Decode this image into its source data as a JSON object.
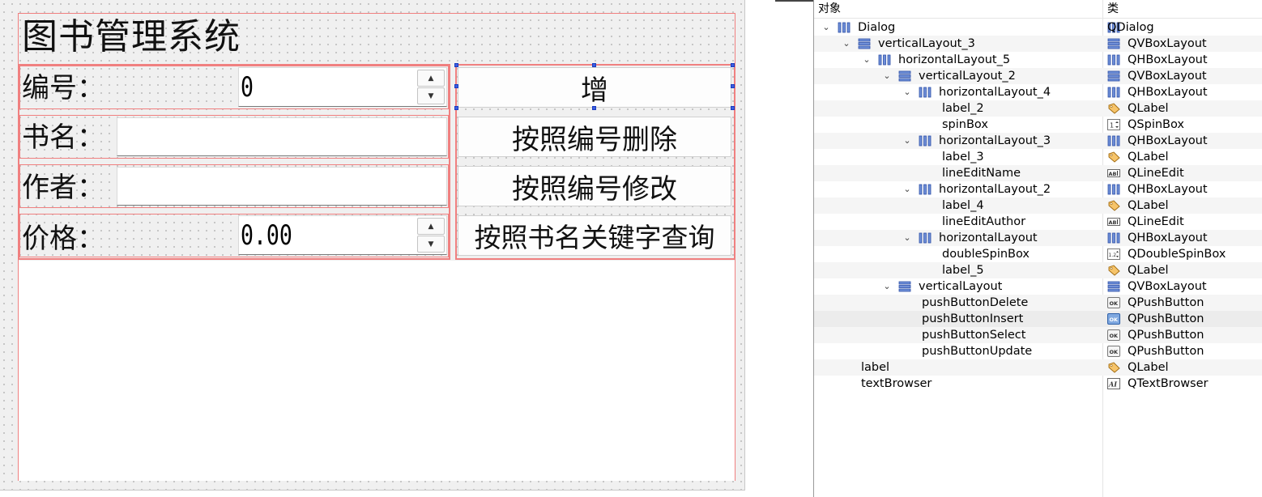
{
  "dialog": {
    "title": "图书管理系统",
    "fields": {
      "id_label": "编号：",
      "id_value": "0",
      "name_label": "书名：",
      "author_label": "作者：",
      "price_label": "价格：",
      "price_value": "0.00"
    },
    "buttons": {
      "insert": "增",
      "delete_by_id": "按照编号删除",
      "update_by_id": "按照编号修改",
      "search_by_keyword": "按照书名关键字查询"
    }
  },
  "inspector": {
    "header": {
      "object": "对象",
      "class": "类"
    },
    "rows": [
      {
        "name": "Dialog",
        "class": "QDialog",
        "icon": "hbox-icon",
        "cicon": "",
        "expand": true
      },
      {
        "name": "verticalLayout_3",
        "class": "QVBoxLayout",
        "icon": "vbox-icon",
        "cicon": "vbox-icon",
        "expand": true
      },
      {
        "name": "horizontalLayout_5",
        "class": "QHBoxLayout",
        "icon": "hbox-icon",
        "cicon": "hbox-icon",
        "expand": true
      },
      {
        "name": "verticalLayout_2",
        "class": "QVBoxLayout",
        "icon": "vbox-icon",
        "cicon": "vbox-icon",
        "expand": true
      },
      {
        "name": "horizontalLayout_4",
        "class": "QHBoxLayout",
        "icon": "hbox-icon",
        "cicon": "hbox-icon",
        "expand": true
      },
      {
        "name": "label_2",
        "class": "QLabel",
        "icon": "",
        "cicon": "label-icon",
        "expand": false
      },
      {
        "name": "spinBox",
        "class": "QSpinBox",
        "icon": "",
        "cicon": "spinbox-icon",
        "expand": false
      },
      {
        "name": "horizontalLayout_3",
        "class": "QHBoxLayout",
        "icon": "hbox-icon",
        "cicon": "hbox-icon",
        "expand": true
      },
      {
        "name": "label_3",
        "class": "QLabel",
        "icon": "",
        "cicon": "label-icon",
        "expand": false
      },
      {
        "name": "lineEditName",
        "class": "QLineEdit",
        "icon": "",
        "cicon": "lineedit-icon",
        "expand": false
      },
      {
        "name": "horizontalLayout_2",
        "class": "QHBoxLayout",
        "icon": "hbox-icon",
        "cicon": "hbox-icon",
        "expand": true
      },
      {
        "name": "label_4",
        "class": "QLabel",
        "icon": "",
        "cicon": "label-icon",
        "expand": false
      },
      {
        "name": "lineEditAuthor",
        "class": "QLineEdit",
        "icon": "",
        "cicon": "lineedit-icon",
        "expand": false
      },
      {
        "name": "horizontalLayout",
        "class": "QHBoxLayout",
        "icon": "hbox-icon",
        "cicon": "hbox-icon",
        "expand": true
      },
      {
        "name": "doubleSpinBox",
        "class": "QDoubleSpinBox",
        "icon": "",
        "cicon": "doublespin-icon",
        "expand": false
      },
      {
        "name": "label_5",
        "class": "QLabel",
        "icon": "",
        "cicon": "label-icon",
        "expand": false
      },
      {
        "name": "verticalLayout",
        "class": "QVBoxLayout",
        "icon": "vbox-icon",
        "cicon": "vbox-icon",
        "expand": true
      },
      {
        "name": "pushButtonDelete",
        "class": "QPushButton",
        "icon": "",
        "cicon": "pushbutton-icon",
        "expand": false
      },
      {
        "name": "pushButtonInsert",
        "class": "QPushButton",
        "icon": "",
        "cicon": "pushbutton-icon-selected",
        "expand": false
      },
      {
        "name": "pushButtonSelect",
        "class": "QPushButton",
        "icon": "",
        "cicon": "pushbutton-icon",
        "expand": false
      },
      {
        "name": "pushButtonUpdate",
        "class": "QPushButton",
        "icon": "",
        "cicon": "pushbutton-icon",
        "expand": false
      },
      {
        "name": "label",
        "class": "QLabel",
        "icon": "",
        "cicon": "label-icon",
        "expand": false
      },
      {
        "name": "textBrowser",
        "class": "QTextBrowser",
        "icon": "",
        "cicon": "textbrowser-icon",
        "expand": false
      }
    ]
  }
}
